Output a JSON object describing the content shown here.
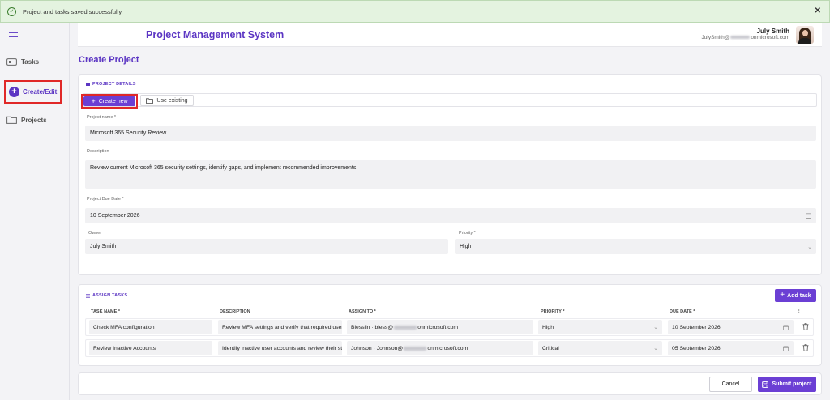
{
  "toast": {
    "message": "Project and tasks saved successfully."
  },
  "header": {
    "app_title": "Project Management System",
    "user_name": "July Smith",
    "user_email_prefix": "JulySmith@",
    "user_email_suffix": "onmicrosoft.com"
  },
  "sidebar": {
    "items": [
      {
        "label": "Tasks",
        "icon": "tasks-icon"
      },
      {
        "label": "Create/Edit",
        "icon": "plus-circle-icon",
        "active": true
      },
      {
        "label": "Projects",
        "icon": "folder-icon"
      }
    ]
  },
  "page": {
    "title": "Create Project"
  },
  "project_details": {
    "section_title": "PROJECT DETAILS",
    "create_new_label": "Create new",
    "use_existing_label": "Use existing",
    "project_name_label": "Project name *",
    "project_name_value": "Microsoft 365 Security Review",
    "description_label": "Description",
    "description_value": "Review current Microsoft 365 security settings, identify gaps, and implement recommended improvements.",
    "due_date_label": "Project Due Date *",
    "due_date_value": "10 September 2026",
    "owner_label": "Owner",
    "owner_value": "July Smith",
    "priority_label": "Priority *",
    "priority_value": "High"
  },
  "assign_tasks": {
    "section_title": "ASSIGN TASKS",
    "add_task_label": "Add task",
    "columns": [
      "TASK NAME *",
      "DESCRIPTION",
      "ASSIGN TO *",
      "PRIORITY *",
      "DUE DATE *",
      "⋮"
    ],
    "rows": [
      {
        "task_name": "Check MFA configuration",
        "description": "Review MFA settings and verify that required user...",
        "assign_to_prefix": "Blesslin · bless@",
        "assign_to_suffix": "onmicrosoft.com",
        "priority": "High",
        "due_date": "10 September 2026"
      },
      {
        "task_name": "Review Inactive Accounts",
        "description": "Identify inactive user accounts and review their sta...",
        "assign_to_prefix": "Johnson · Johnson@",
        "assign_to_suffix": "onmicrosoft.com",
        "priority": "Critical",
        "due_date": "05 September 2026"
      }
    ]
  },
  "footer": {
    "cancel_label": "Cancel",
    "submit_label": "Submit project"
  },
  "colors": {
    "accent": "#6b3fd4",
    "title": "#5b35c3",
    "toast_bg": "#e4f3e0",
    "highlight_border": "#e02828"
  }
}
